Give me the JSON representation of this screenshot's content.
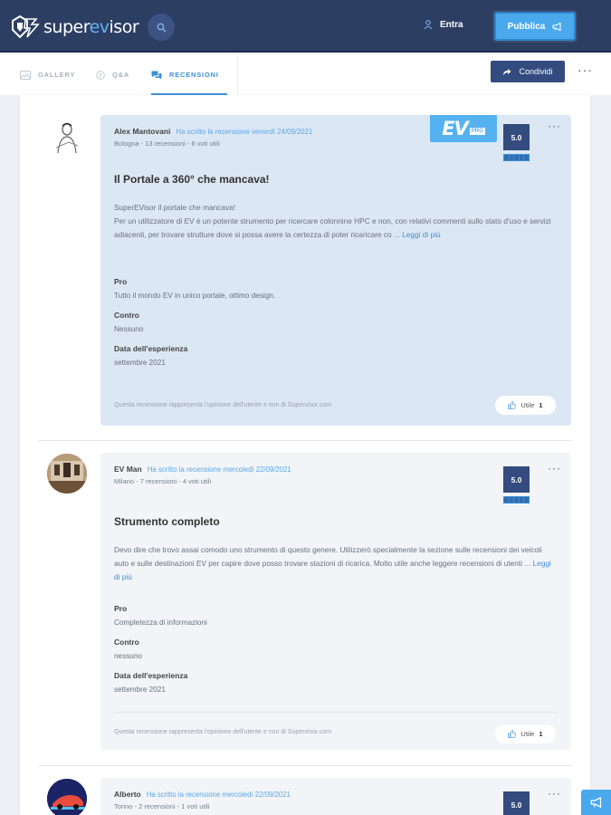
{
  "header": {
    "logo_text_pre": "super",
    "logo_text_ev": "ev",
    "logo_text_post": "isor",
    "login_label": "Entra",
    "publish_label": "Pubblica"
  },
  "tabs": [
    {
      "label": "GALLERY",
      "icon": "image-icon"
    },
    {
      "label": "Q&A",
      "icon": "question-icon"
    },
    {
      "label": "RECENSIONI",
      "icon": "chat-icon",
      "active": true
    }
  ],
  "share_label": "Condividi",
  "more_label": "···",
  "colors": {
    "header_bg": "#2d3e63",
    "accent": "#4aa8ec",
    "score_bg": "#334b7e",
    "highlight_card": "#dce7f4"
  },
  "reviews": [
    {
      "author": "Alex Mantovani",
      "when": "Ha scritto la recensione venerdì 24/09/2021",
      "stats": "Bologna - 13 recensioni - 6 voti utili",
      "score": "5.0",
      "badge_text": "EV",
      "badge_sub": "PRO",
      "title": "Il Portale a 360° che mancava!",
      "body_line1": "SuperEVisor il portale che mancava!",
      "body_rest": "Per un utilizzatore di EV è un potente strumento per ricercare colonnine HPC e non, con relativi commenti sullo stato d'uso e servizi adiacenti, per trovare strutture dove si possa avere la certezza di poter ricaricare co",
      "read_more": "... Leggi di più",
      "pro_label": "Pro",
      "pro": "Tutto il mondo EV in unico portale, ottimo design.",
      "contro_label": "Contro",
      "contro": "Nessuno",
      "date_label": "Data dell'esperienza",
      "date": "settembre 2021",
      "disclaimer": "Questa recensione rappresenta l'opinione dell'utente e non di Supervisor.com",
      "useful_label": "Utile",
      "useful_count": "1"
    },
    {
      "author": "EV Man",
      "when": "Ha scritto la recensione mercoledì 22/09/2021",
      "stats": "Milano - 7 recensioni - 4 voti utili",
      "score": "5.0",
      "title": "Strumento completo",
      "body": "Devo dire che trovo assai comodo uno strumento di questo genere. Utilizzerò specialmente la sezione sulle recensioni dei veicoli auto e sulle destinazioni EV per capire dove posso trovare stazioni di ricarica. Molto utile anche leggere recensioni di utenti",
      "read_more": "... Leggi di più",
      "pro_label": "Pro",
      "pro": "Completezza di informazioni",
      "contro_label": "Contro",
      "contro": "nessuno",
      "date_label": "Data dell'esperienza",
      "date": "settembre 2021",
      "disclaimer": "Questa recensione rappresenta l'opinione dell'utente e non di Supervisor.com",
      "useful_label": "Utile",
      "useful_count": "1"
    },
    {
      "author": "Alberto",
      "when": "Ha scritto la recensione mercoledì 22/09/2021",
      "stats": "Torino - 2 recensioni - 1 voti utili",
      "score": "5.0"
    }
  ]
}
